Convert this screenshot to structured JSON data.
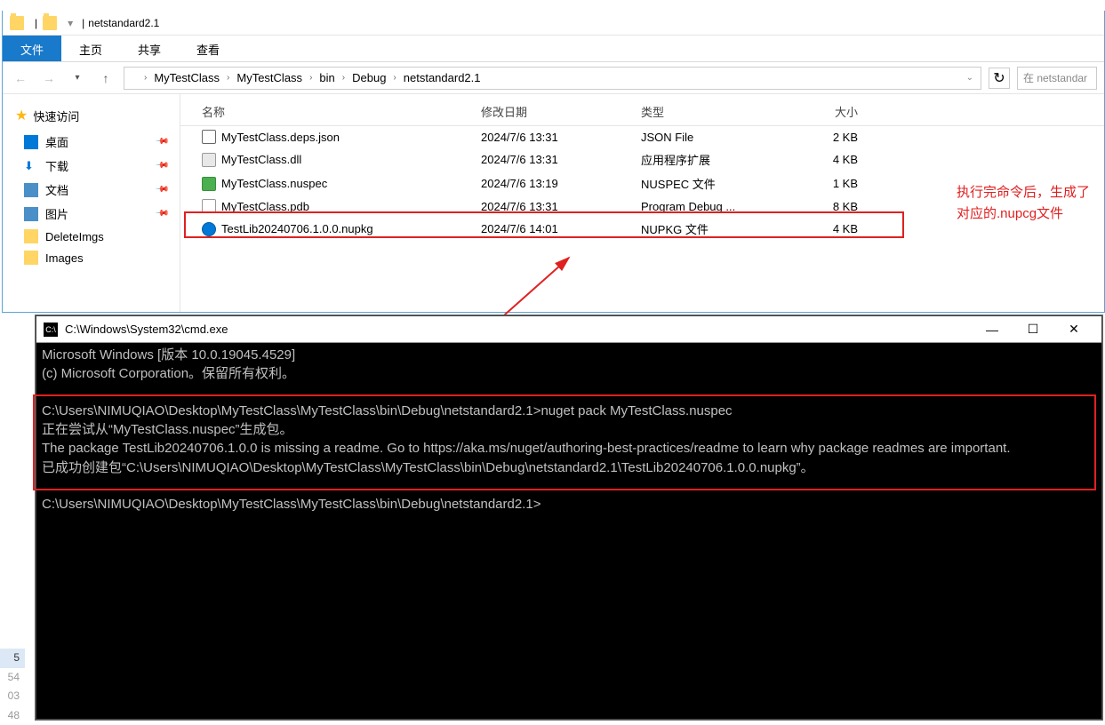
{
  "explorer": {
    "title": "netstandard2.1",
    "tabs": {
      "file": "文件",
      "home": "主页",
      "share": "共享",
      "view": "查看"
    },
    "breadcrumb": [
      "MyTestClass",
      "MyTestClass",
      "bin",
      "Debug",
      "netstandard2.1"
    ],
    "search_placeholder": "在 netstandar",
    "columns": {
      "name": "名称",
      "date": "修改日期",
      "type": "类型",
      "size": "大小"
    },
    "sidebar": {
      "quick": "快速访问",
      "items": [
        {
          "label": "桌面",
          "pinned": true
        },
        {
          "label": "下载",
          "pinned": true
        },
        {
          "label": "文档",
          "pinned": true
        },
        {
          "label": "图片",
          "pinned": true
        },
        {
          "label": "DeleteImgs",
          "pinned": false
        },
        {
          "label": "Images",
          "pinned": false
        }
      ]
    },
    "files": [
      {
        "ico": "json",
        "name": "MyTestClass.deps.json",
        "date": "2024/7/6 13:31",
        "type": "JSON File",
        "size": "2 KB"
      },
      {
        "ico": "dll",
        "name": "MyTestClass.dll",
        "date": "2024/7/6 13:31",
        "type": "应用程序扩展",
        "size": "4 KB"
      },
      {
        "ico": "nuspec",
        "name": "MyTestClass.nuspec",
        "date": "2024/7/6 13:19",
        "type": "NUSPEC 文件",
        "size": "1 KB"
      },
      {
        "ico": "pdb",
        "name": "MyTestClass.pdb",
        "date": "2024/7/6 13:31",
        "type": "Program Debug ...",
        "size": "8 KB"
      },
      {
        "ico": "nupkg",
        "name": "TestLib20240706.1.0.0.nupkg",
        "date": "2024/7/6 14:01",
        "type": "NUPKG 文件",
        "size": "4 KB"
      }
    ]
  },
  "annotation": {
    "line1": "执行完命令后，生成了",
    "line2": "对应的.nupcg文件"
  },
  "cmd": {
    "title": "C:\\Windows\\System32\\cmd.exe",
    "l1": "Microsoft Windows [版本 10.0.19045.4529]",
    "l2": "(c) Microsoft Corporation。保留所有权利。",
    "prompt1_path": "C:\\Users\\NIMUQIAO\\Desktop\\MyTestClass\\MyTestClass\\bin\\Debug\\netstandard2.1>",
    "cmd1": "nuget pack MyTestClass.nuspec",
    "out1": "正在尝试从“MyTestClass.nuspec”生成包。",
    "out2": "The package TestLib20240706.1.0.0 is missing a readme. Go to https://aka.ms/nuget/authoring-best-practices/readme to learn why package readmes are important.",
    "out3": "已成功创建包“C:\\Users\\NIMUQIAO\\Desktop\\MyTestClass\\MyTestClass\\bin\\Debug\\netstandard2.1\\TestLib20240706.1.0.0.nupkg”。",
    "prompt2": "C:\\Users\\NIMUQIAO\\Desktop\\MyTestClass\\MyTestClass\\bin\\Debug\\netstandard2.1>"
  },
  "linenums": [
    "5",
    "54",
    "03",
    "48"
  ]
}
